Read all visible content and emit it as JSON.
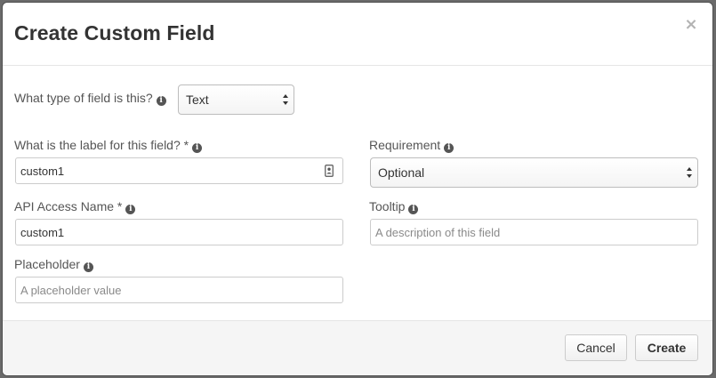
{
  "dialog": {
    "title": "Create Custom Field",
    "close_glyph": "×"
  },
  "fields": {
    "type": {
      "label": "What type of field is this?",
      "value": "Text",
      "icon": "info-icon"
    },
    "label_field": {
      "label": "What is the label for this field? *",
      "value": "custom1",
      "icon": "info-icon",
      "trailing_icon": "contact-card-icon"
    },
    "requirement": {
      "label": "Requirement",
      "value": "Optional",
      "icon": "info-icon"
    },
    "api_name": {
      "label": "API Access Name *",
      "value": "custom1",
      "icon": "info-icon"
    },
    "tooltip": {
      "label": "Tooltip",
      "value": "",
      "placeholder": "A description of this field",
      "icon": "info-icon"
    },
    "placeholder": {
      "label": "Placeholder",
      "value": "",
      "placeholder": "A placeholder value",
      "icon": "info-icon"
    }
  },
  "footer": {
    "cancel_label": "Cancel",
    "create_label": "Create"
  },
  "colors": {
    "overlay": "#6a6a6a",
    "dialog_bg": "#ffffff",
    "footer_bg": "#f5f5f5",
    "title_text": "#333333",
    "label_text": "#555555",
    "input_border": "#cccccc"
  }
}
